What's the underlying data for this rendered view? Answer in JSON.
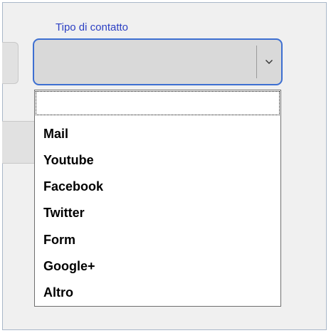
{
  "field": {
    "label": "Tipo di contatto",
    "value": ""
  },
  "dropdown": {
    "options": [
      "",
      "Mail",
      "Youtube",
      "Facebook",
      "Twitter",
      "Form",
      "Google+",
      "Altro"
    ]
  },
  "icons": {
    "combo_arrow": "chevron-down-icon"
  }
}
